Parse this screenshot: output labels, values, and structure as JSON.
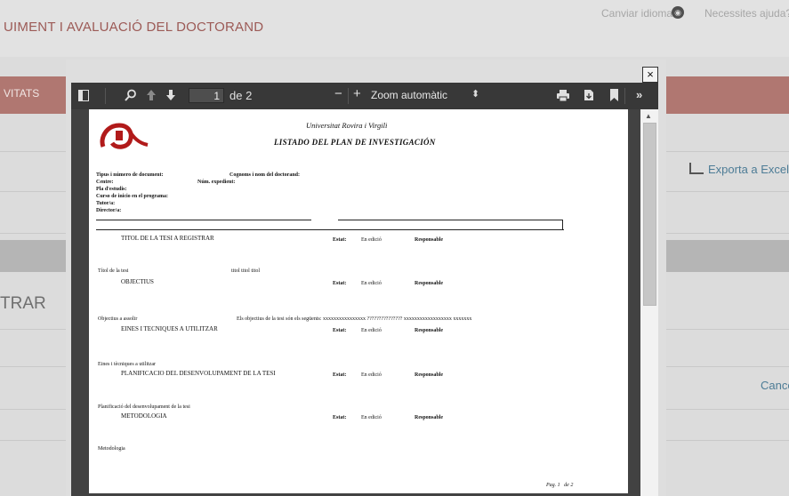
{
  "background": {
    "page_title": "UIMENT I AVALUACIÓ DEL DOCTORAND",
    "change_language": "Canviar idioma",
    "help": "Necessites ajuda?",
    "nav_label": "VITATS",
    "section_heading": "TRAR",
    "export_label": "Exporta a Excel",
    "cancel_label": "Cance",
    "close_symbol": "×"
  },
  "viewer": {
    "toolbar": {
      "page_number": "1",
      "page_total": "de 2",
      "zoom_out": "−",
      "zoom_in": "+",
      "zoom_label": "Zoom automàtic",
      "more": "»"
    },
    "document": {
      "university": "Universitat Rovira i Virgili",
      "title": "LISTADO DEL PLAN DE INVESTIGACIÓN",
      "fields": {
        "doc_type": "Tipus i número de document:",
        "name": "Cognoms i nom del doctorand:",
        "centre": "Centre:",
        "file_no": "Núm. expedient:",
        "study_plan": "Pla d'estudis:",
        "start_year": "Curso de inicio en el programa:",
        "tutor": "Tutor/a:",
        "director": "Director/a:"
      },
      "sections": [
        {
          "heading": "TITOL DE LA TESI A REGISTRAR",
          "field_label": "",
          "field_value": "",
          "estat_label": "Estat:",
          "estat_value": "En edició",
          "responsable": "Responsable"
        },
        {
          "heading": "OBJECTIUS",
          "field_label": "Títol de la tesi",
          "field_value": "titol titol titol",
          "estat_label": "Estat:",
          "estat_value": "En edició",
          "responsable": "Responsable"
        },
        {
          "heading": "EINES I TECNIQUES A UTILITZAR",
          "field_label": "Objectius a assolir",
          "field_value": "Els objectius de la tesi són els següents:  xxxxxxxxxxxxxxxx  ???????????????  xxxxxxxxxxxxxxxxxx  xxxxxxx",
          "estat_label": "Estat:",
          "estat_value": "En edició",
          "responsable": "Responsable"
        },
        {
          "heading": "PLANIFICACIO DEL DESENVOLUPAMENT DE LA TESI",
          "field_label": "Eines i tècniques a utilitzar",
          "field_value": "",
          "estat_label": "Estat:",
          "estat_value": "En edició",
          "responsable": "Responsable"
        },
        {
          "heading": "METODOLOGIA",
          "field_label": "Planificació del desenvolupament de la tesi",
          "field_value": "",
          "estat_label": "Estat:",
          "estat_value": "En edició",
          "responsable": "Responsable"
        }
      ],
      "last_label": "Metodologia",
      "footer_page": "Pag. 1",
      "footer_total": "de 2"
    }
  }
}
